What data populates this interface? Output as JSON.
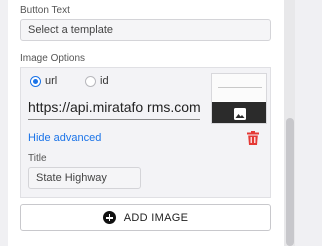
{
  "button_text": {
    "label": "Button Text",
    "placeholder": "Select a template"
  },
  "image_options": {
    "label": "Image Options",
    "source_options": [
      {
        "label": "url",
        "selected": true
      },
      {
        "label": "id",
        "selected": false
      }
    ],
    "url_value": "https://api.miratafo rms.com/",
    "hide_advanced_label": "Hide advanced",
    "title_label": "Title",
    "title_value": "State Highway",
    "thumbnail_icon": "image-icon",
    "delete_icon": "trash-icon"
  },
  "add_image_label": "ADD IMAGE",
  "colors": {
    "accent": "#1a73e8",
    "delete": "#e53935"
  }
}
